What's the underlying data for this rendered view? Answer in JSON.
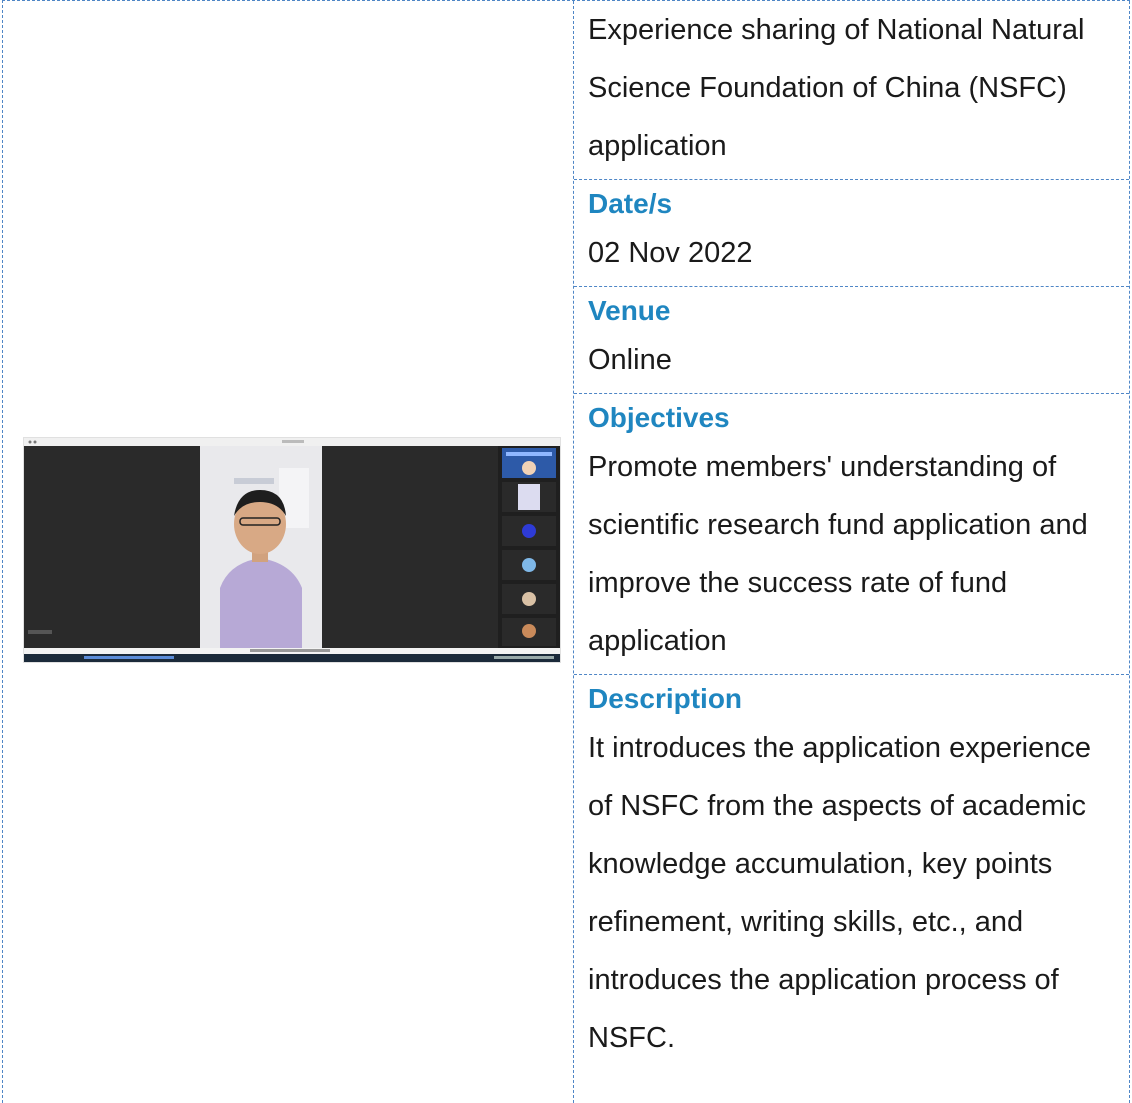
{
  "event": {
    "title": "Experience sharing of National Natural Science Foundation of China (NSFC) application",
    "date_label": "Date/s",
    "date_value": "02 Nov 2022",
    "venue_label": "Venue",
    "venue_value": "Online",
    "objectives_label": "Objectives",
    "objectives_value": "Promote members' understanding of scientific research fund application and improve the success rate of fund application",
    "description_label": "Description",
    "description_value": "It introduces the application experience of NSFC from the aspects of academic knowledge accumulation, key points refinement, writing skills, etc., and introduces the application process of NSFC."
  },
  "colors": {
    "heading": "#1f86c0",
    "border": "#4f86c6",
    "text": "#1a1a1a",
    "app_background": "#2b2b2b",
    "panel_background": "#1f1f1f",
    "shirt": "#b7a9d6"
  }
}
